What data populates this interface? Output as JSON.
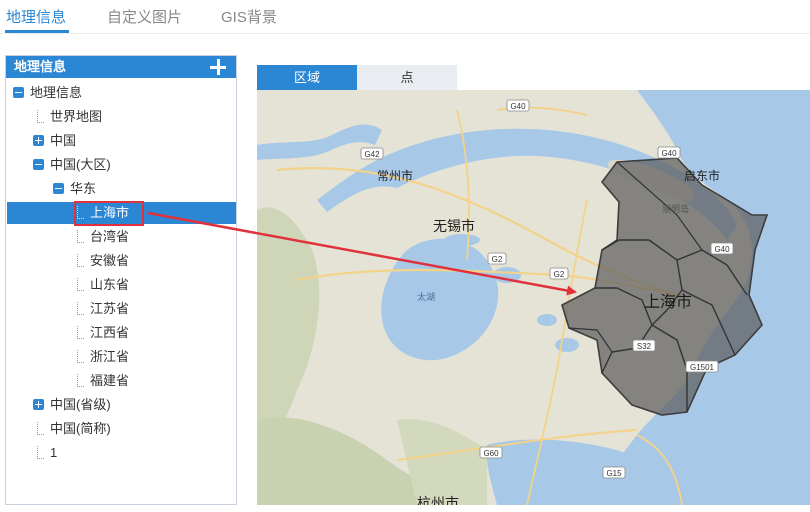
{
  "top_tabs": [
    {
      "label": "地理信息",
      "active": true
    },
    {
      "label": "自定义图片",
      "active": false
    },
    {
      "label": "GIS背景",
      "active": false
    }
  ],
  "tree_panel": {
    "title": "地理信息",
    "add_icon": "plus-icon",
    "items": [
      {
        "label": "地理信息",
        "toggle": "minus"
      },
      {
        "label": "世界地图",
        "toggle": "none"
      },
      {
        "label": "中国",
        "toggle": "plus"
      },
      {
        "label": "中国(大区)",
        "toggle": "minus"
      },
      {
        "label": "华东",
        "toggle": "minus"
      },
      {
        "label": "上海市",
        "toggle": "none",
        "selected": true
      },
      {
        "label": "台湾省",
        "toggle": "none"
      },
      {
        "label": "安徽省",
        "toggle": "none"
      },
      {
        "label": "山东省",
        "toggle": "none"
      },
      {
        "label": "江苏省",
        "toggle": "none"
      },
      {
        "label": "江西省",
        "toggle": "none"
      },
      {
        "label": "浙江省",
        "toggle": "none"
      },
      {
        "label": "福建省",
        "toggle": "none"
      },
      {
        "label": "中国(省级)",
        "toggle": "plus"
      },
      {
        "label": "中国(简称)",
        "toggle": "none"
      },
      {
        "label": "1",
        "toggle": "none"
      }
    ]
  },
  "map_tabs": [
    {
      "label": "区域",
      "active": true
    },
    {
      "label": "点",
      "active": false
    }
  ],
  "map": {
    "city_labels": {
      "changzhou": "常州市",
      "wuxi": "无锡市",
      "qidong": "启东市",
      "shanghai": "上海市",
      "taihu": "太湖",
      "chongming": "崇明岛",
      "hangzhou": "杭州市"
    },
    "road_shields": {
      "g40_top": "G40",
      "g42": "G42",
      "g40_right": "G40",
      "g40_east": "G40",
      "g2_a": "G2",
      "g2_b": "G2",
      "s32": "S32",
      "g1501": "G1501",
      "g60": "G60",
      "g15": "G15"
    }
  },
  "colors": {
    "accent": "#2b86d4",
    "highlight_red": "#e0323c",
    "water": "#a8c8e8",
    "land": "#e4e3d6",
    "region_fill": "#6b6b6b"
  }
}
